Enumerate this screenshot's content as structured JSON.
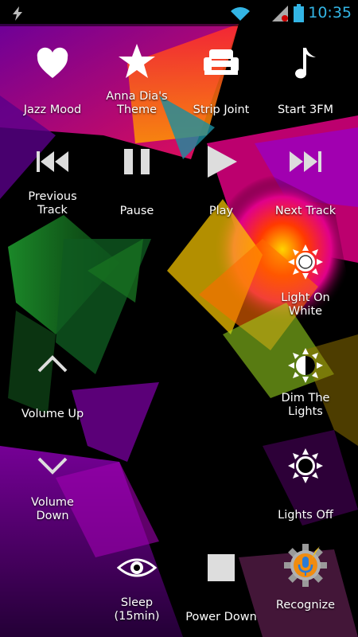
{
  "statusbar": {
    "time": "10:35",
    "icons": [
      "bolt-icon",
      "wifi-icon",
      "signal-icon",
      "battery-icon"
    ],
    "time_color": "#33b5e5"
  },
  "tiles": {
    "jazz_mood": {
      "label": "Jazz Mood",
      "icon": "heart-icon"
    },
    "anna_dia": {
      "label": "Anna Dia's\nTheme",
      "icon": "star-icon"
    },
    "strip_joint": {
      "label": "Strip Joint",
      "icon": "sofa-icon"
    },
    "start_3fm": {
      "label": "Start 3FM",
      "icon": "music-note-icon"
    },
    "previous_track": {
      "label": "Previous\nTrack",
      "icon": "skip-back-icon"
    },
    "pause": {
      "label": "Pause",
      "icon": "pause-icon"
    },
    "play": {
      "label": "Play",
      "icon": "play-icon"
    },
    "next_track": {
      "label": "Next Track",
      "icon": "skip-forward-icon"
    },
    "light_on_white": {
      "label": "Light On\nWhite",
      "icon": "sun-icon"
    },
    "volume_up": {
      "label": "Volume Up",
      "icon": "chevron-up-icon"
    },
    "dim_lights": {
      "label": "Dim The\nLights",
      "icon": "half-sun-icon"
    },
    "volume_down": {
      "label": "Volume\nDown",
      "icon": "chevron-down-icon"
    },
    "lights_off": {
      "label": "Lights Off",
      "icon": "sun-outline-icon"
    },
    "sleep": {
      "label": "Sleep\n(15min)",
      "icon": "eye-icon"
    },
    "power_down": {
      "label": "Power Down",
      "icon": "stop-icon"
    },
    "recognize": {
      "label": "Recognize",
      "icon": "gear-mic-icon"
    }
  }
}
